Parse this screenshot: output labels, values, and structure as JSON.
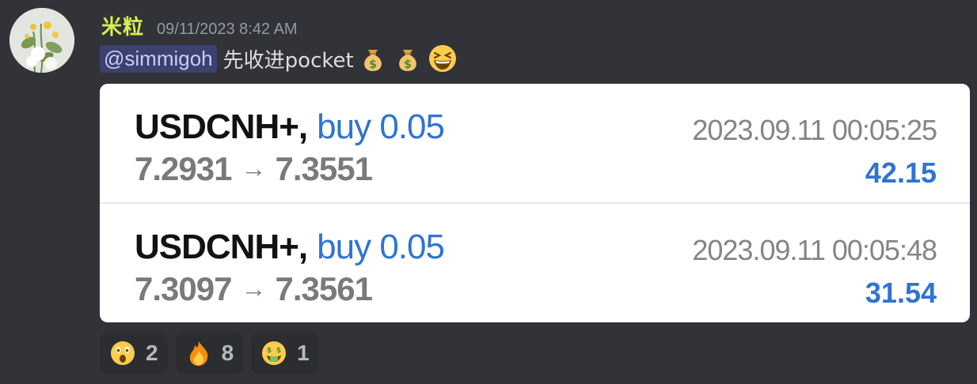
{
  "post": {
    "username": "米粒",
    "timestamp": "09/11/2023 8:42 AM",
    "mention": "@simmigoh",
    "text": "先收进pocket",
    "inline_emojis": [
      "money-bag-icon",
      "money-bag-icon",
      "grinning-squinting-face-icon"
    ]
  },
  "trades": [
    {
      "symbol": "USDCNH+,",
      "side": "buy 0.05",
      "open_price": "7.2931",
      "arrow": "→",
      "close_price": "7.3551",
      "time": "2023.09.11 00:05:25",
      "profit": "42.15"
    },
    {
      "symbol": "USDCNH+,",
      "side": "buy 0.05",
      "open_price": "7.3097",
      "arrow": "→",
      "close_price": "7.3561",
      "time": "2023.09.11 00:05:48",
      "profit": "31.54"
    }
  ],
  "reactions": [
    {
      "icon": "astonished-face-icon",
      "count": "2"
    },
    {
      "icon": "fire-icon",
      "count": "8"
    },
    {
      "icon": "money-mouth-face-icon",
      "count": "1"
    }
  ],
  "colors": {
    "background": "#313338",
    "username": "#d7ee4f",
    "mention_bg": "#3c4270",
    "accent_blue": "#2f74d0"
  }
}
